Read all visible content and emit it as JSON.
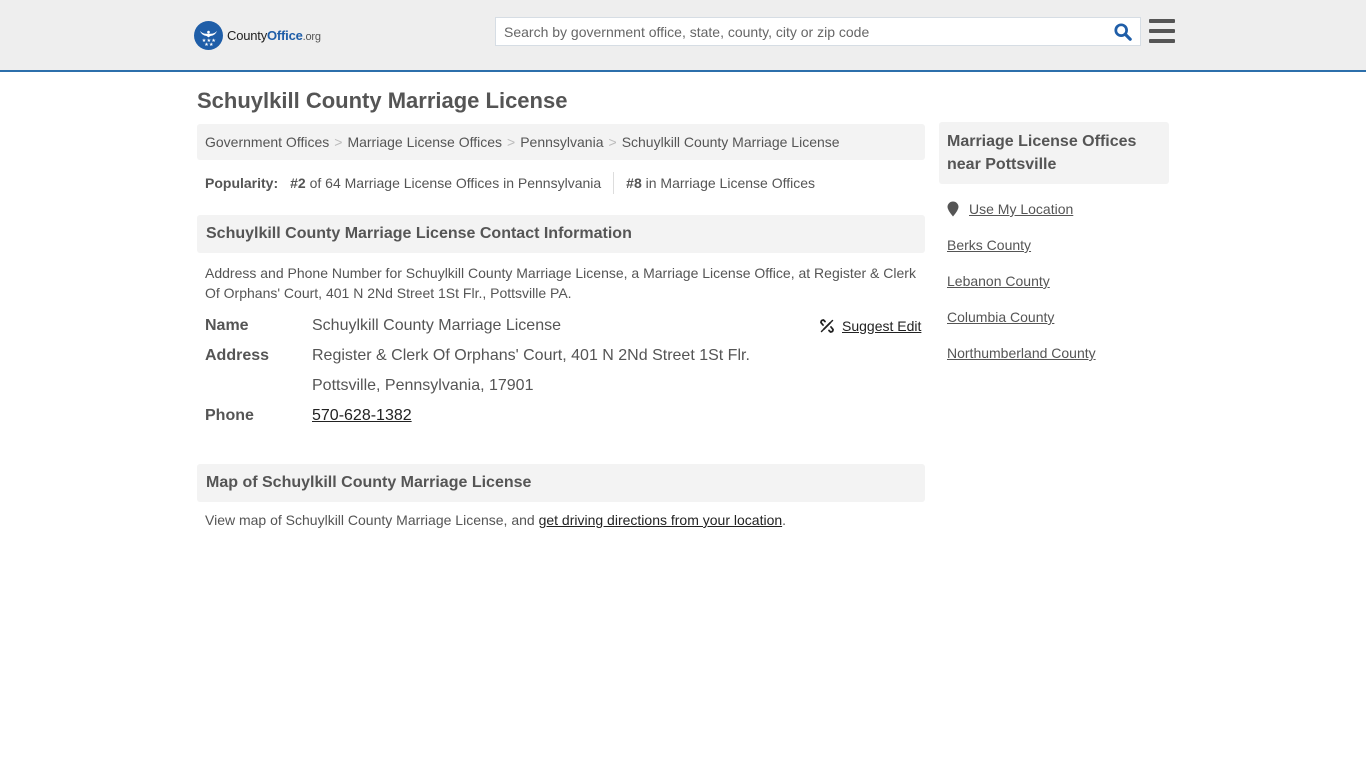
{
  "brand": {
    "name_part1": "County",
    "name_part2": "Office",
    "name_part3": ".org",
    "accent": "#1f5ea8",
    "header_border": "#2c6fab"
  },
  "search": {
    "placeholder": "Search by government office, state, county, city or zip code",
    "value": ""
  },
  "icons": {
    "search": "search-icon",
    "menu": "hamburger-menu-icon",
    "edit": "broken-link-icon",
    "location": "map-pin-icon",
    "logo": "eagle-stars-icon"
  },
  "page": {
    "title": "Schuylkill County Marriage License"
  },
  "breadcrumb": [
    {
      "label": "Government Offices"
    },
    {
      "label": "Marriage License Offices"
    },
    {
      "label": "Pennsylvania"
    },
    {
      "label": "Schuylkill County Marriage License"
    }
  ],
  "breadcrumb_separator": ">",
  "popularity": {
    "label": "Popularity:",
    "rank_state": "#2",
    "rank_state_text": "of 64 Marriage License Offices in Pennsylvania",
    "rank_national": "#8",
    "rank_national_text": "in Marriage License Offices"
  },
  "contact": {
    "heading": "Schuylkill County Marriage License Contact Information",
    "description": "Address and Phone Number for Schuylkill County Marriage License, a Marriage License Office, at Register & Clerk Of Orphans' Court, 401 N 2Nd Street 1St Flr., Pottsville PA.",
    "suggest_edit": "Suggest Edit",
    "name_label": "Name",
    "name_value": "Schuylkill County Marriage License",
    "address_label": "Address",
    "address_line1": "Register & Clerk Of Orphans' Court, 401 N 2Nd Street 1St Flr.",
    "address_line2": "Pottsville, Pennsylvania, 17901",
    "phone_label": "Phone",
    "phone_value": "570-628-1382"
  },
  "map": {
    "heading": "Map of Schuylkill County Marriage License",
    "text_before": "View map of Schuylkill County Marriage License, and ",
    "link": "get driving directions from your location",
    "text_after": "."
  },
  "sidebar": {
    "heading": "Marriage License Offices near Pottsville",
    "use_location": "Use My Location",
    "links": [
      {
        "label": "Berks County"
      },
      {
        "label": "Lebanon County"
      },
      {
        "label": "Columbia County"
      },
      {
        "label": "Northumberland County"
      }
    ]
  }
}
